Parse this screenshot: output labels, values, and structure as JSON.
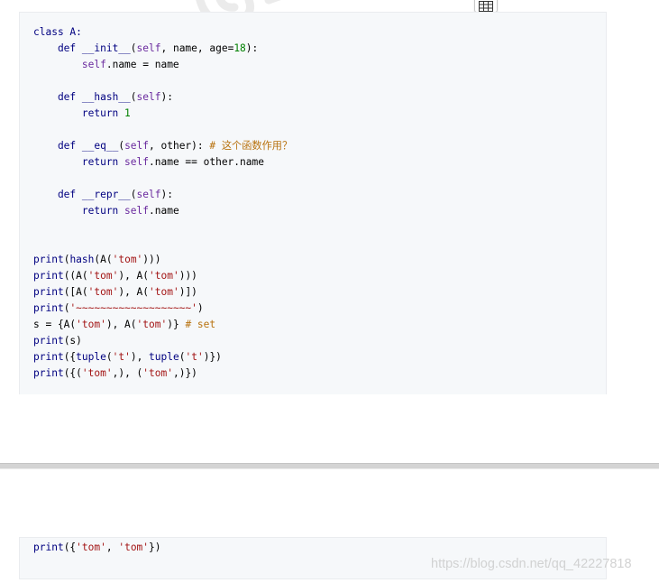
{
  "toolbar": {
    "icon": "table-icon"
  },
  "colors": {
    "code_background": "#f6f8fa",
    "code_border": "#eaecef",
    "keyword": "#000080",
    "string": "#a31515",
    "number": "#008000",
    "comment": "#b8720f",
    "divider": "#d4d4d4"
  },
  "code_blocks": [
    {
      "lines": [
        [
          {
            "t": "class A:",
            "c": "keyword"
          }
        ],
        [
          {
            "t": "    def ",
            "c": "keyword"
          },
          {
            "t": "__init__",
            "c": "func"
          },
          {
            "t": "(",
            "c": "punct"
          },
          {
            "t": "self",
            "c": "self"
          },
          {
            "t": ", name, age=",
            "c": "default"
          },
          {
            "t": "18",
            "c": "number"
          },
          {
            "t": "):",
            "c": "punct"
          }
        ],
        [
          {
            "t": "        ",
            "c": "default"
          },
          {
            "t": "self",
            "c": "self"
          },
          {
            "t": ".name = name",
            "c": "default"
          }
        ],
        [
          {
            "t": "",
            "c": "default"
          }
        ],
        [
          {
            "t": "    def ",
            "c": "keyword"
          },
          {
            "t": "__hash__",
            "c": "func"
          },
          {
            "t": "(",
            "c": "punct"
          },
          {
            "t": "self",
            "c": "self"
          },
          {
            "t": "):",
            "c": "punct"
          }
        ],
        [
          {
            "t": "        return ",
            "c": "keyword"
          },
          {
            "t": "1",
            "c": "number"
          }
        ],
        [
          {
            "t": "",
            "c": "default"
          }
        ],
        [
          {
            "t": "    def ",
            "c": "keyword"
          },
          {
            "t": "__eq__",
            "c": "func"
          },
          {
            "t": "(",
            "c": "punct"
          },
          {
            "t": "self",
            "c": "self"
          },
          {
            "t": ", other): ",
            "c": "default"
          },
          {
            "t": "# 这个函数作用？",
            "c": "comment"
          }
        ],
        [
          {
            "t": "        return ",
            "c": "keyword"
          },
          {
            "t": "self",
            "c": "self"
          },
          {
            "t": ".name == other.name",
            "c": "default"
          }
        ],
        [
          {
            "t": "",
            "c": "default"
          }
        ],
        [
          {
            "t": "    def ",
            "c": "keyword"
          },
          {
            "t": "__repr__",
            "c": "func"
          },
          {
            "t": "(",
            "c": "punct"
          },
          {
            "t": "self",
            "c": "self"
          },
          {
            "t": "):",
            "c": "punct"
          }
        ],
        [
          {
            "t": "        return ",
            "c": "keyword"
          },
          {
            "t": "self",
            "c": "self"
          },
          {
            "t": ".name",
            "c": "default"
          }
        ],
        [
          {
            "t": "",
            "c": "default"
          }
        ],
        [
          {
            "t": "",
            "c": "default"
          }
        ],
        [
          {
            "t": "print",
            "c": "builtin"
          },
          {
            "t": "(",
            "c": "punct"
          },
          {
            "t": "hash",
            "c": "builtin"
          },
          {
            "t": "(A(",
            "c": "default"
          },
          {
            "t": "'tom'",
            "c": "string"
          },
          {
            "t": ")))",
            "c": "punct"
          }
        ],
        [
          {
            "t": "print",
            "c": "builtin"
          },
          {
            "t": "((A(",
            "c": "default"
          },
          {
            "t": "'tom'",
            "c": "string"
          },
          {
            "t": "), A(",
            "c": "default"
          },
          {
            "t": "'tom'",
            "c": "string"
          },
          {
            "t": ")))",
            "c": "punct"
          }
        ],
        [
          {
            "t": "print",
            "c": "builtin"
          },
          {
            "t": "([A(",
            "c": "default"
          },
          {
            "t": "'tom'",
            "c": "string"
          },
          {
            "t": "), A(",
            "c": "default"
          },
          {
            "t": "'tom'",
            "c": "string"
          },
          {
            "t": ")])",
            "c": "punct"
          }
        ],
        [
          {
            "t": "print",
            "c": "builtin"
          },
          {
            "t": "(",
            "c": "punct"
          },
          {
            "t": "'~~~~~~~~~~~~~~~~~~~'",
            "c": "string"
          },
          {
            "t": ")",
            "c": "punct"
          }
        ],
        [
          {
            "t": "s = {A(",
            "c": "default"
          },
          {
            "t": "'tom'",
            "c": "string"
          },
          {
            "t": "), A(",
            "c": "default"
          },
          {
            "t": "'tom'",
            "c": "string"
          },
          {
            "t": ")} ",
            "c": "default"
          },
          {
            "t": "# set",
            "c": "comment"
          }
        ],
        [
          {
            "t": "print",
            "c": "builtin"
          },
          {
            "t": "(s)",
            "c": "default"
          }
        ],
        [
          {
            "t": "print",
            "c": "builtin"
          },
          {
            "t": "({",
            "c": "default"
          },
          {
            "t": "tuple",
            "c": "builtin"
          },
          {
            "t": "(",
            "c": "punct"
          },
          {
            "t": "'t'",
            "c": "string"
          },
          {
            "t": "), ",
            "c": "default"
          },
          {
            "t": "tuple",
            "c": "builtin"
          },
          {
            "t": "(",
            "c": "punct"
          },
          {
            "t": "'t'",
            "c": "string"
          },
          {
            "t": ")})",
            "c": "punct"
          }
        ],
        [
          {
            "t": "print",
            "c": "builtin"
          },
          {
            "t": "({(",
            "c": "default"
          },
          {
            "t": "'tom'",
            "c": "string"
          },
          {
            "t": ",), (",
            "c": "default"
          },
          {
            "t": "'tom'",
            "c": "string"
          },
          {
            "t": ",)})",
            "c": "punct"
          }
        ]
      ]
    },
    {
      "lines": [
        [
          {
            "t": "print",
            "c": "builtin"
          },
          {
            "t": "({",
            "c": "default"
          },
          {
            "t": "'tom'",
            "c": "string"
          },
          {
            "t": ", ",
            "c": "default"
          },
          {
            "t": "'tom'",
            "c": "string"
          },
          {
            "t": "})",
            "c": "punct"
          }
        ]
      ]
    }
  ],
  "watermark": {
    "text": "https://blog.csdn.net/qq_42227818"
  }
}
